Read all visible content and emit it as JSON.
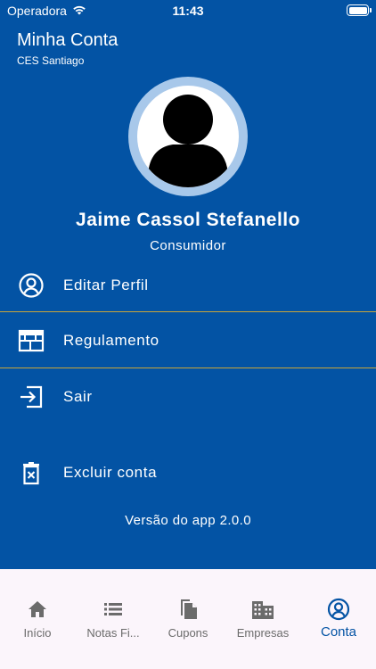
{
  "status_bar": {
    "carrier": "Operadora",
    "time": "11:43"
  },
  "header": {
    "title": "Minha Conta",
    "subtitle": "CES Santiago"
  },
  "profile": {
    "name": "Jaime Cassol Stefanello",
    "role": "Consumidor"
  },
  "menu": [
    {
      "label": "Editar Perfil",
      "icon": "user-circle-icon"
    },
    {
      "label": "Regulamento",
      "icon": "calendar-icon"
    },
    {
      "label": "Sair",
      "icon": "logout-icon"
    },
    {
      "label": "Excluir conta",
      "icon": "trash-icon"
    }
  ],
  "version": "Versão do app 2.0.0",
  "tabs": [
    {
      "label": "Início",
      "icon": "home-icon",
      "active": false
    },
    {
      "label": "Notas Fi...",
      "icon": "list-icon",
      "active": false
    },
    {
      "label": "Cupons",
      "icon": "coupon-icon",
      "active": false
    },
    {
      "label": "Empresas",
      "icon": "building-icon",
      "active": false
    },
    {
      "label": "Conta",
      "icon": "account-icon",
      "active": true
    }
  ],
  "colors": {
    "background": "#0353a4",
    "divider": "#c9a53a",
    "tabbar": "#fbf5fb",
    "active_tab": "#0353a4",
    "inactive_tab": "#6b6b6b"
  }
}
